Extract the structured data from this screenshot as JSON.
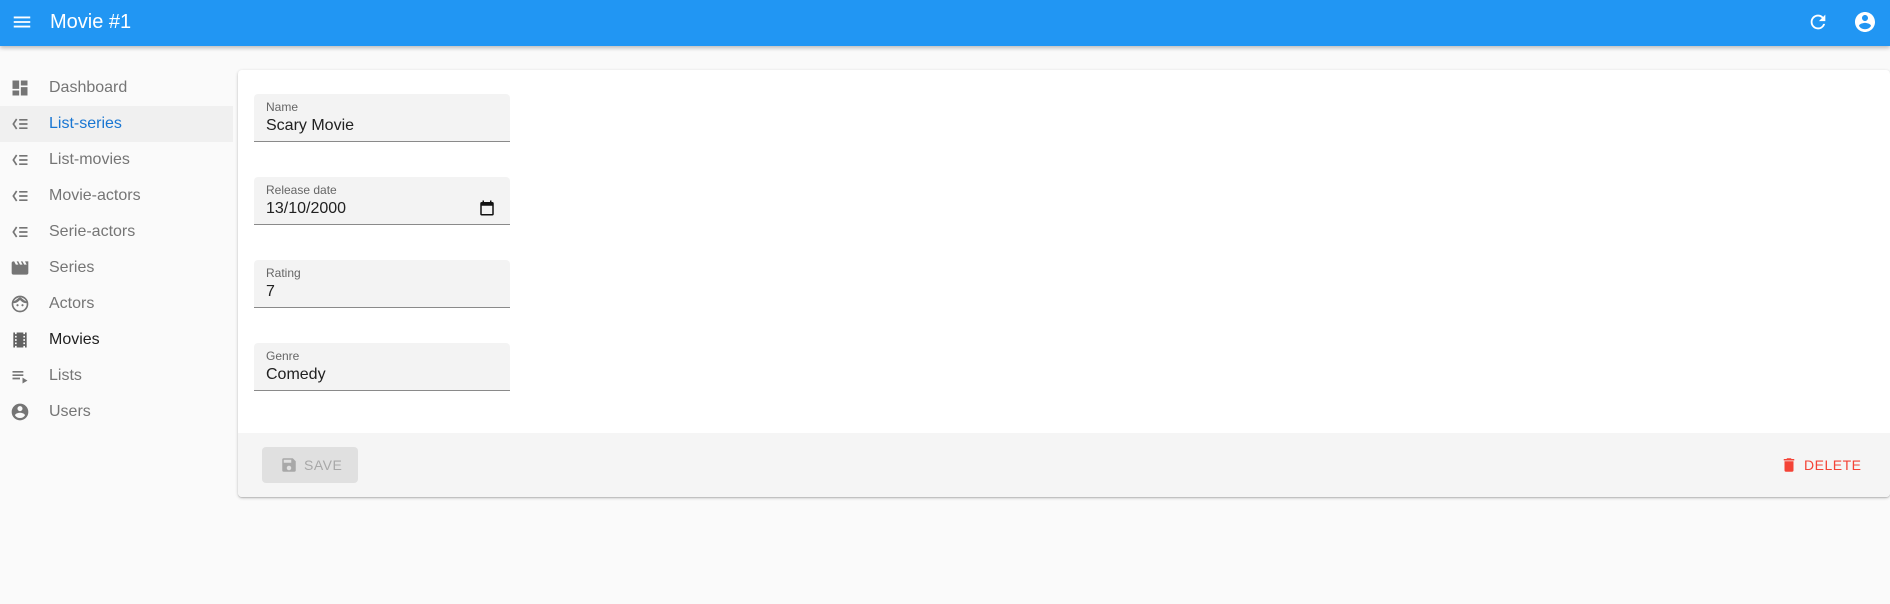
{
  "app_bar": {
    "title": "Movie #1",
    "menu_icon": "menu-icon",
    "refresh_icon": "refresh-icon",
    "account_icon": "account-circle-icon",
    "background": "#2196f3"
  },
  "sidebar": {
    "items": [
      {
        "label": "Dashboard",
        "icon": "dashboard-icon"
      },
      {
        "label": "List-series",
        "icon": "list-icon",
        "active": true
      },
      {
        "label": "List-movies",
        "icon": "list-icon"
      },
      {
        "label": "Movie-actors",
        "icon": "list-icon"
      },
      {
        "label": "Serie-actors",
        "icon": "list-icon"
      },
      {
        "label": "Series",
        "icon": "clapperboard-icon"
      },
      {
        "label": "Actors",
        "icon": "face-icon"
      },
      {
        "label": "Movies",
        "icon": "film-icon"
      },
      {
        "label": "Lists",
        "icon": "playlist-icon"
      },
      {
        "label": "Users",
        "icon": "account-circle-icon"
      }
    ],
    "active_color": "#1976d2"
  },
  "form": {
    "fields": [
      {
        "label": "Name",
        "value": "Scary Movie"
      },
      {
        "label": "Release date",
        "value": "13/10/2000"
      },
      {
        "label": "Rating",
        "value": "7"
      },
      {
        "label": "Genre",
        "value": "Comedy"
      }
    ]
  },
  "toolbar": {
    "save_label": "SAVE",
    "save_icon": "save-icon",
    "delete_label": "DELETE",
    "delete_icon": "delete-icon",
    "delete_color": "#f44336"
  }
}
